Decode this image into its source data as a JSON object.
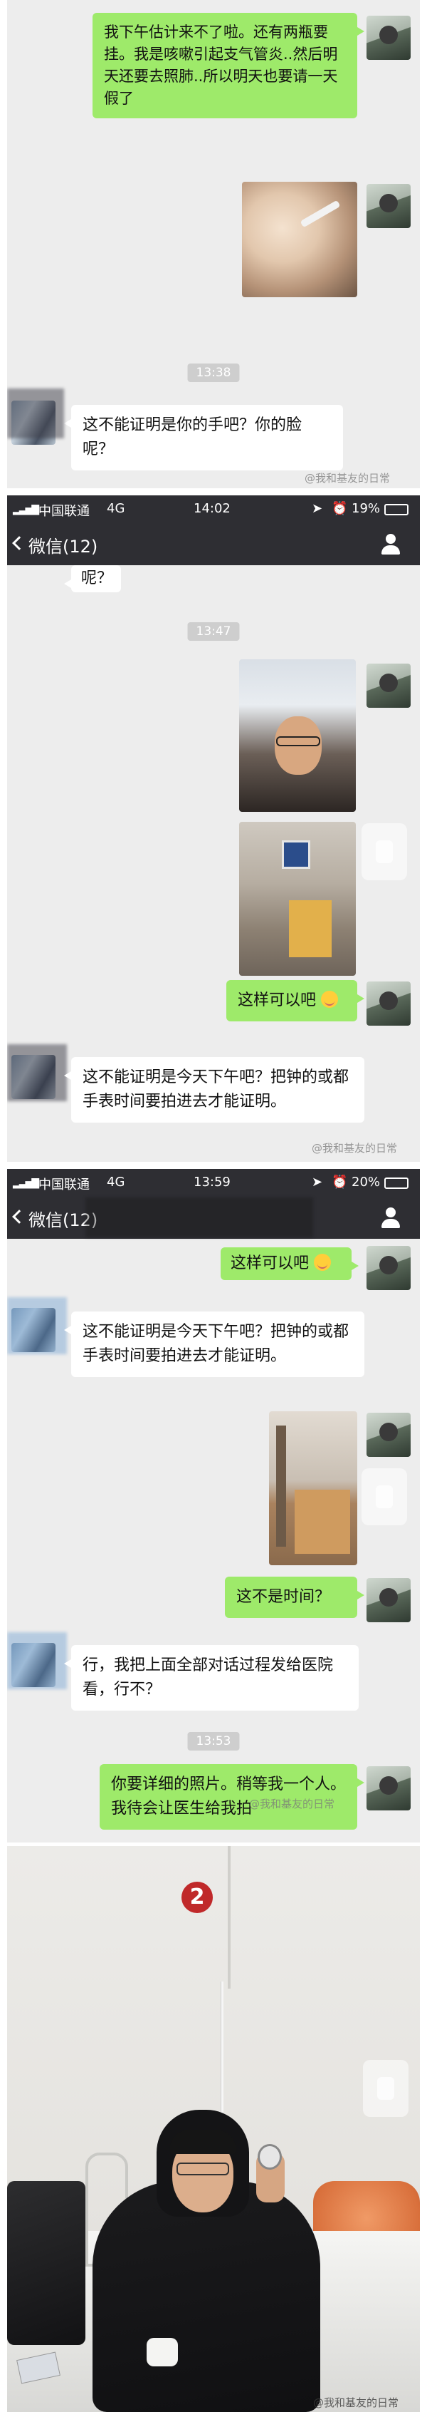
{
  "panel1": {
    "msg_top": "我下午估计来不了啦。还有两瓶要挂。我是咳嗽引起支气管炎..然后明天还要去照肺..所以明天也要请一天假了",
    "time": "13:38",
    "msg_other": "这不能证明是你的手吧？你的脸呢？",
    "watermark": "@我和基友的日常"
  },
  "status_a": {
    "carrier": "中国联通",
    "network": "4G",
    "time": "14:02",
    "battery": "19%"
  },
  "nav_a": {
    "title": "微信(12)"
  },
  "panel2": {
    "partial_text": "呢？",
    "time": "13:47",
    "msg_self": "这样可以吧",
    "msg_other": "这不能证明是今天下午吧？把钟的或都手表时间要拍进去才能证明。",
    "watermark": "@我和基友的日常"
  },
  "status_b": {
    "carrier": "中国联通",
    "network": "4G",
    "time": "13:59",
    "battery": "20%"
  },
  "nav_b": {
    "title": "微信(12)"
  },
  "panel3": {
    "msg_self_1": "这样可以吧",
    "msg_other_1": "这不能证明是今天下午吧？把钟的或都手表时间要拍进去才能证明。",
    "msg_self_2": "这不是时间？",
    "msg_other_2": "行，我把上面全部对话过程发给医院看，行不？",
    "time": "13:53",
    "msg_self_3": "你要详细的照片。稍等我一个人。我待会让医生给我拍",
    "watermark": "@我和基友的日常"
  },
  "panel4": {
    "badge": "2",
    "watermark": "@我和基友的日常"
  }
}
